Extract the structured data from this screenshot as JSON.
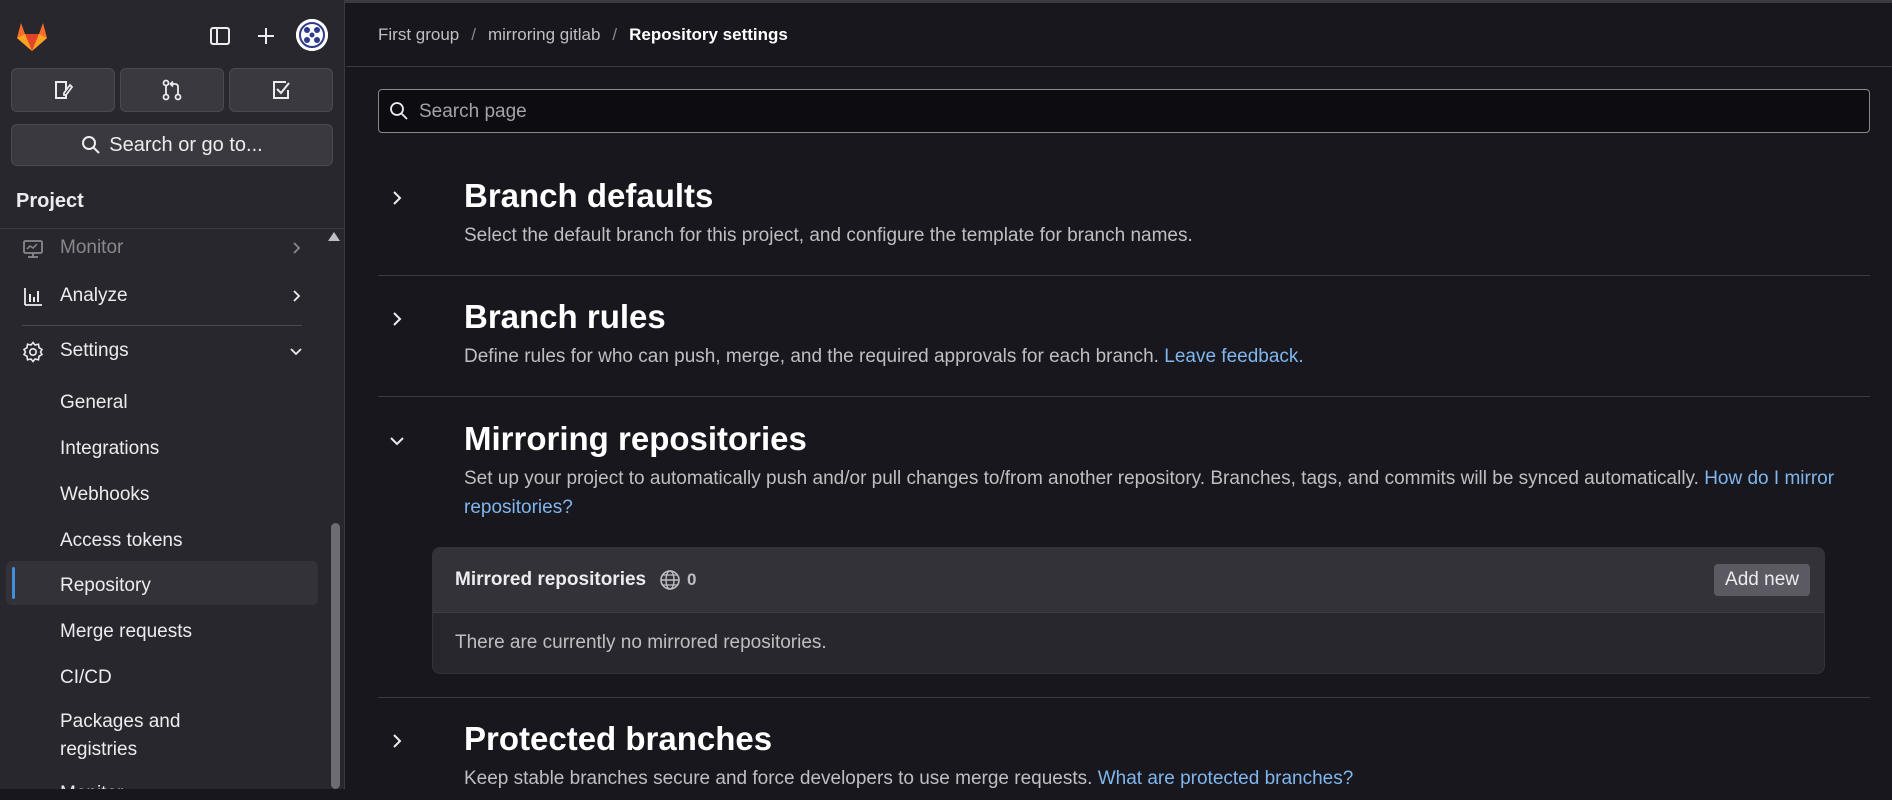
{
  "sidebar": {
    "search_label": "Search or go to...",
    "section_title": "Project",
    "nav": {
      "monitor": "Monitor",
      "analyze": "Analyze",
      "settings": "Settings"
    },
    "settings_items": [
      {
        "label": "General"
      },
      {
        "label": "Integrations"
      },
      {
        "label": "Webhooks"
      },
      {
        "label": "Access tokens"
      },
      {
        "label": "Repository"
      },
      {
        "label": "Merge requests"
      },
      {
        "label": "CI/CD"
      },
      {
        "label": "Packages and registries"
      },
      {
        "label": "Monitor"
      }
    ],
    "active_item": "Repository"
  },
  "breadcrumb": {
    "items": [
      "First group",
      "mirroring gitlab"
    ],
    "current": "Repository settings"
  },
  "search": {
    "placeholder": "Search page"
  },
  "sections": {
    "branch_defaults": {
      "title": "Branch defaults",
      "description": "Select the default branch for this project, and configure the template for branch names."
    },
    "branch_rules": {
      "title": "Branch rules",
      "description": "Define rules for who can push, merge, and the required approvals for each branch.",
      "link": "Leave feedback."
    },
    "mirroring": {
      "title": "Mirroring repositories",
      "description": "Set up your project to automatically push and/or pull changes to/from another repository. Branches, tags, and commits will be synced automatically.",
      "link": "How do I mirror repositories?",
      "card": {
        "title": "Mirrored repositories",
        "count": "0",
        "add_button": "Add new",
        "empty_text": "There are currently no mirrored repositories."
      }
    },
    "protected_branches": {
      "title": "Protected branches",
      "description": "Keep stable branches secure and force developers to use merge requests.",
      "link": "What are protected branches?"
    }
  },
  "colors": {
    "background": "#18171d",
    "sidebar": "#28272d",
    "link": "#7fb6ed",
    "active_indicator": "#428fdc",
    "brand_orange": "#fc6d26"
  }
}
